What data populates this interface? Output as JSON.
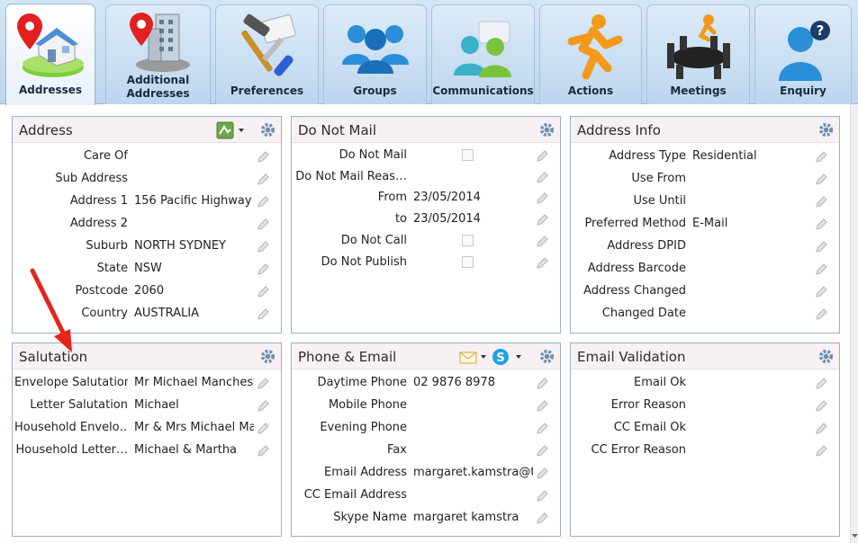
{
  "tabs": [
    {
      "label": "Addresses",
      "icon": "map-pin-house-icon"
    },
    {
      "label": "Additional Addresses",
      "icon": "map-pin-building-icon"
    },
    {
      "label": "Preferences",
      "icon": "hammer-screwdriver-icon"
    },
    {
      "label": "Groups",
      "icon": "people-group-icon"
    },
    {
      "label": "Communications",
      "icon": "people-chat-icon"
    },
    {
      "label": "Actions",
      "icon": "running-person-icon"
    },
    {
      "label": "Meetings",
      "icon": "meeting-table-icon"
    },
    {
      "label": "Enquiry",
      "icon": "person-question-icon"
    }
  ],
  "address": {
    "title": "Address",
    "fields": [
      {
        "label": "Care Of",
        "value": ""
      },
      {
        "label": "Sub Address",
        "value": ""
      },
      {
        "label": "Address 1",
        "value": "156 Pacific Highway"
      },
      {
        "label": "Address 2",
        "value": ""
      },
      {
        "label": "Suburb",
        "value": "NORTH SYDNEY"
      },
      {
        "label": "State",
        "value": "NSW"
      },
      {
        "label": "Postcode",
        "value": "2060"
      },
      {
        "label": "Country",
        "value": "AUSTRALIA"
      }
    ]
  },
  "donotmail": {
    "title": "Do Not Mail",
    "fields": [
      {
        "label": "Do Not Mail",
        "value": "",
        "type": "checkbox"
      },
      {
        "label": "Do Not Mail Reas…",
        "value": ""
      },
      {
        "label": "From",
        "value": "23/05/2014"
      },
      {
        "label": "to",
        "value": "23/05/2014"
      },
      {
        "label": "Do Not Call",
        "value": "",
        "type": "checkbox"
      },
      {
        "label": "Do Not Publish",
        "value": "",
        "type": "checkbox"
      }
    ]
  },
  "addressinfo": {
    "title": "Address Info",
    "fields": [
      {
        "label": "Address Type",
        "value": "Residential"
      },
      {
        "label": "Use From",
        "value": ""
      },
      {
        "label": "Use Until",
        "value": ""
      },
      {
        "label": "Preferred Method",
        "value": "E-Mail"
      },
      {
        "label": "Address DPID",
        "value": ""
      },
      {
        "label": "Address Barcode",
        "value": ""
      },
      {
        "label": "Address Changed",
        "value": ""
      },
      {
        "label": "Changed Date",
        "value": ""
      }
    ]
  },
  "salutation": {
    "title": "Salutation",
    "fields": [
      {
        "label": "Envelope Salutation",
        "value": "Mr Michael Manchest"
      },
      {
        "label": "Letter Salutation",
        "value": "Michael"
      },
      {
        "label": "Household Envelo…",
        "value": "Mr & Mrs Michael Ma"
      },
      {
        "label": "Household Letter…",
        "value": "Michael & Martha"
      }
    ]
  },
  "phone": {
    "title": "Phone & Email",
    "fields": [
      {
        "label": "Daytime Phone",
        "value": "02 9876 8978"
      },
      {
        "label": "Mobile Phone",
        "value": ""
      },
      {
        "label": "Evening Phone",
        "value": ""
      },
      {
        "label": "Fax",
        "value": ""
      },
      {
        "label": "Email Address",
        "value": "margaret.kamstra@th"
      },
      {
        "label": "CC Email Address",
        "value": ""
      },
      {
        "label": "Skype Name",
        "value": "margaret kamstra"
      }
    ]
  },
  "emailvalidation": {
    "title": "Email Validation",
    "fields": [
      {
        "label": "Email Ok",
        "value": ""
      },
      {
        "label": "Error Reason",
        "value": ""
      },
      {
        "label": "CC Email Ok",
        "value": ""
      },
      {
        "label": "CC Error Reason",
        "value": ""
      }
    ]
  },
  "colors": {
    "annotation_arrow": "#e8231c",
    "header_bg": "#f7f1f4",
    "tab_bg": "#cfe3f5"
  }
}
